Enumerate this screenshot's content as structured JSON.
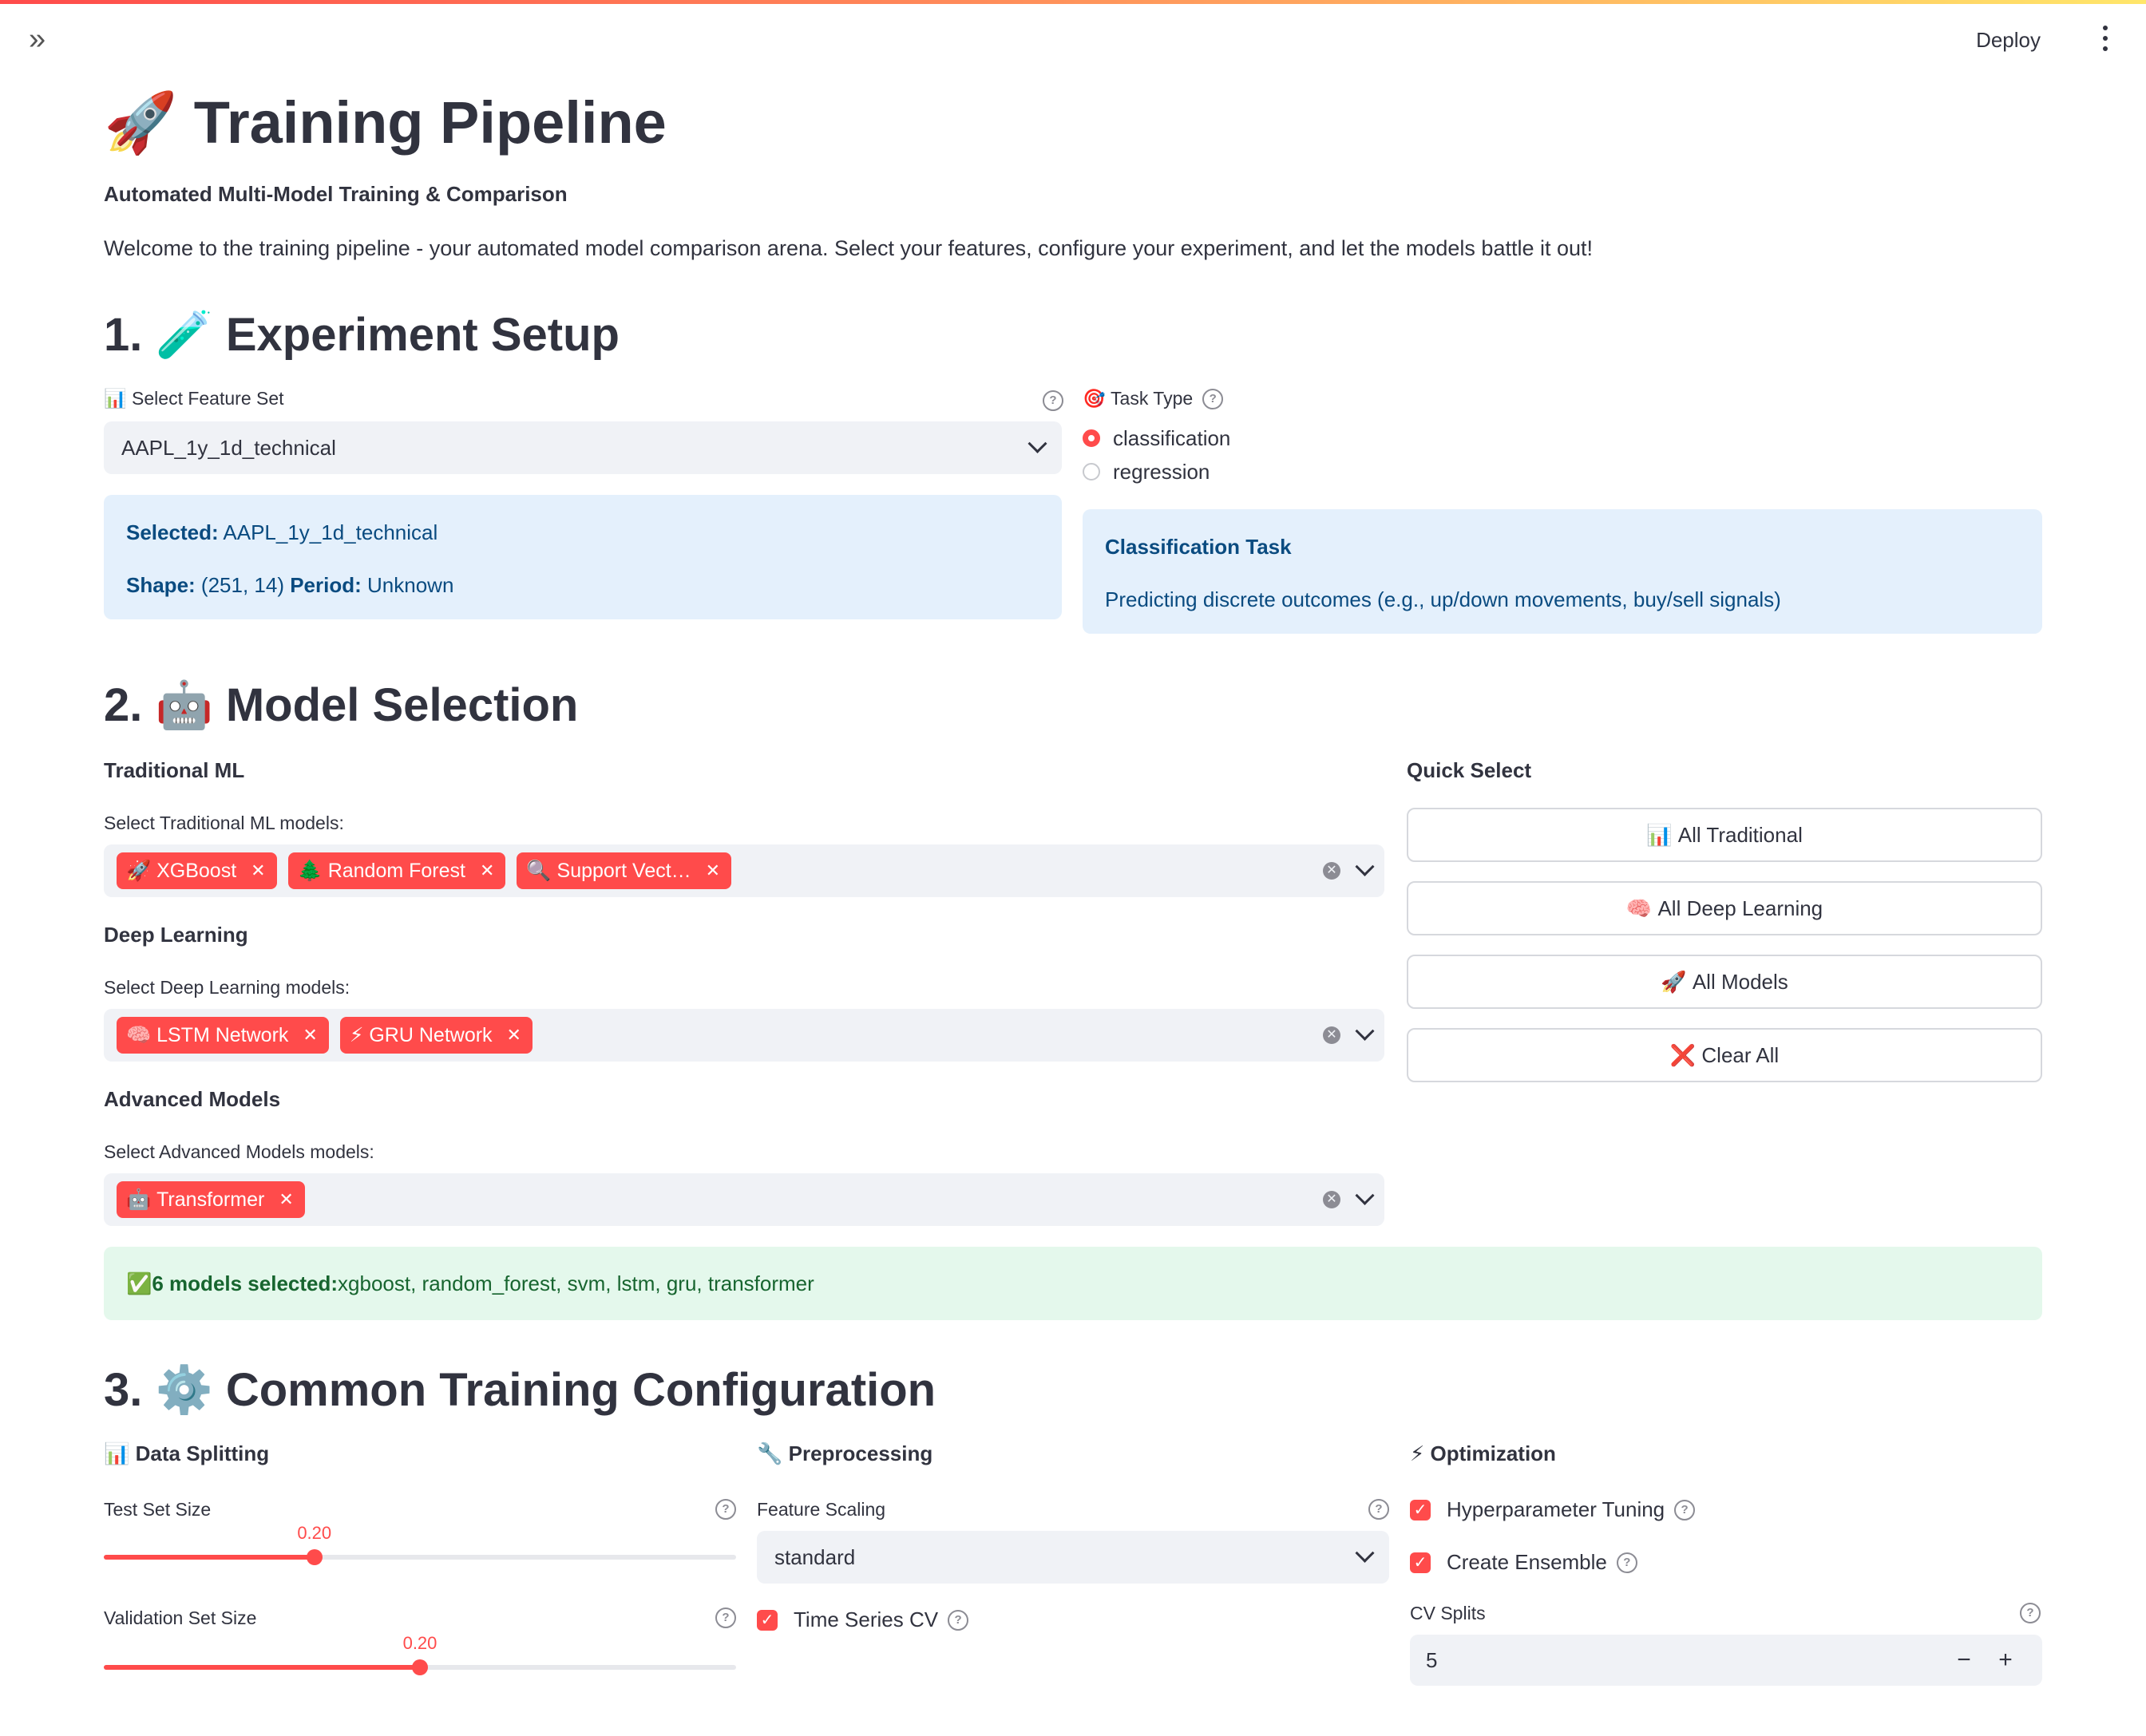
{
  "header": {
    "deploy_label": "Deploy",
    "expand_icon": "»"
  },
  "page": {
    "title_icon": "🚀",
    "title": "Training Pipeline",
    "subtitle": "Automated Multi-Model Training & Comparison",
    "intro": "Welcome to the training pipeline - your automated model comparison arena. Select your features, configure your experiment, and let the models battle it out!"
  },
  "section1": {
    "heading_num": "1.",
    "heading_icon": "🧪",
    "heading": "Experiment Setup",
    "feature_set": {
      "icon": "📊",
      "label": "Select Feature Set",
      "value": "AAPL_1y_1d_technical"
    },
    "info": {
      "selected_label": "Selected:",
      "selected_value": " AAPL_1y_1d_technical",
      "shape_label": "Shape:",
      "shape_value": " (251, 14) ",
      "period_label": "Period:",
      "period_value": " Unknown"
    },
    "task_type": {
      "icon": "🎯",
      "label": "Task Type",
      "options": [
        "classification",
        "regression"
      ],
      "selected": "classification"
    },
    "task_info": {
      "title": "Classification Task",
      "body": "Predicting discrete outcomes (e.g., up/down movements, buy/sell signals)"
    }
  },
  "section2": {
    "heading_num": "2.",
    "heading_icon": "🤖",
    "heading": "Model Selection",
    "traditional": {
      "title": "Traditional ML",
      "label": "Select Traditional ML models:",
      "chips": [
        {
          "icon": "🚀",
          "label": "XGBoost"
        },
        {
          "icon": "🌲",
          "label": "Random Forest"
        },
        {
          "icon": "🔍",
          "label": "Support Vect…"
        }
      ]
    },
    "deep": {
      "title": "Deep Learning",
      "label": "Select Deep Learning models:",
      "chips": [
        {
          "icon": "🧠",
          "label": "LSTM Network"
        },
        {
          "icon": "⚡",
          "label": "GRU Network"
        }
      ]
    },
    "advanced": {
      "title": "Advanced Models",
      "label": "Select Advanced Models models:",
      "chips": [
        {
          "icon": "🤖",
          "label": "Transformer"
        }
      ]
    },
    "quick_select": {
      "title": "Quick Select",
      "buttons": [
        {
          "icon": "📊",
          "label": "All Traditional"
        },
        {
          "icon": "🧠",
          "label": "All Deep Learning"
        },
        {
          "icon": "🚀",
          "label": "All Models"
        },
        {
          "icon": "❌",
          "label": "Clear All"
        }
      ]
    },
    "summary": {
      "icon": "✅",
      "count_label": "6 models selected:",
      "models": " xgboost, random_forest, svm, lstm, gru, transformer"
    }
  },
  "section3": {
    "heading_num": "3.",
    "heading_icon": "⚙️",
    "heading": "Common Training Configuration",
    "data_splitting": {
      "icon": "📊",
      "title": "Data Splitting",
      "test_label": "Test Set Size",
      "test_value": "0.20",
      "test_fraction": 0.333,
      "val_label": "Validation Set Size",
      "val_value": "0.20",
      "val_fraction": 0.5
    },
    "preprocessing": {
      "icon": "🔧",
      "title": "Preprocessing",
      "scaling_label": "Feature Scaling",
      "scaling_value": "standard",
      "ts_cv_label": "Time Series CV",
      "ts_cv_checked": true
    },
    "optimization": {
      "icon": "⚡",
      "title": "Optimization",
      "hp_label": "Hyperparameter Tuning",
      "hp_checked": true,
      "ensemble_label": "Create Ensemble",
      "ensemble_checked": true,
      "cv_label": "CV Splits",
      "cv_value": "5",
      "minus": "−",
      "plus": "+"
    }
  },
  "colors": {
    "accent": "#ff4b4b",
    "info_bg": "#e4f0fc",
    "info_text": "#0a4b80",
    "success_bg": "#e4f8ec",
    "success_text": "#17652f"
  }
}
